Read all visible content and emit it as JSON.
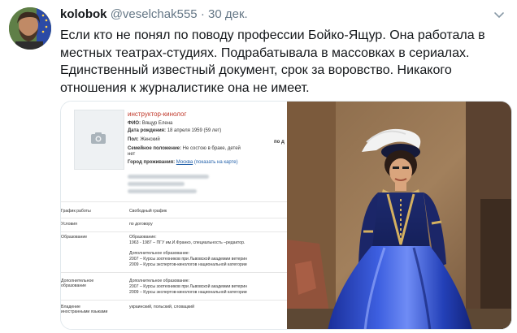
{
  "tweet": {
    "display_name": "kolobok",
    "handle": "@veselchak555",
    "separator": "·",
    "date": "30 дек.",
    "text": "Если кто не понял по поводу профессии Бойко-Ящур. Она работала в местных театрах-студиях. Подрабатывала в массовках в сериалах. Единственный известный документ, срок за воровство. Никакого отношения к журналистике она не имеет."
  },
  "document": {
    "profession": "инструктор-кинолог",
    "fio_label": "ФИО:",
    "fio_value": "Вящур Елена",
    "dob_label": "Дата рождения:",
    "dob_value": "18 апреля 1959 (59 лет)",
    "sex_label": "Пол:",
    "sex_value": "Женский",
    "marital_label": "Семейное положение:",
    "marital_value_1": "Не состою в браке, детей",
    "marital_value_2": "нет",
    "city_label": "Город проживания:",
    "city_value": "Москва",
    "map_link": "(показать на карте)",
    "cut_text": "по д",
    "rows": [
      {
        "label": "График работы",
        "value": "Свободный график"
      },
      {
        "label": "Условия",
        "value": "по договору"
      },
      {
        "label": "Образование",
        "lines": [
          "Образование:",
          "1963 - 1987 – ПГУ им.И.Франко, специальность –редактор.",
          "",
          "Дополнительное образование:",
          "2007 – Курсы зоотехников при Львовской академии ветерин",
          "2009 – Курсы экспертов-кинологов национальной категории"
        ]
      },
      {
        "label": "Дополнительное образование",
        "lines": [
          "Дополнительное образование:",
          "2007 – Курсы зоотехников при Львовской академии ветерин",
          "2009 – Курсы экспертов-кинологов национальной категории"
        ]
      },
      {
        "label": "Владение иностранными языками",
        "value": "украинский, польский, словацкий"
      }
    ]
  },
  "icons": {
    "menu": "chevron-down-icon",
    "photo_placeholder": "camera-icon"
  }
}
